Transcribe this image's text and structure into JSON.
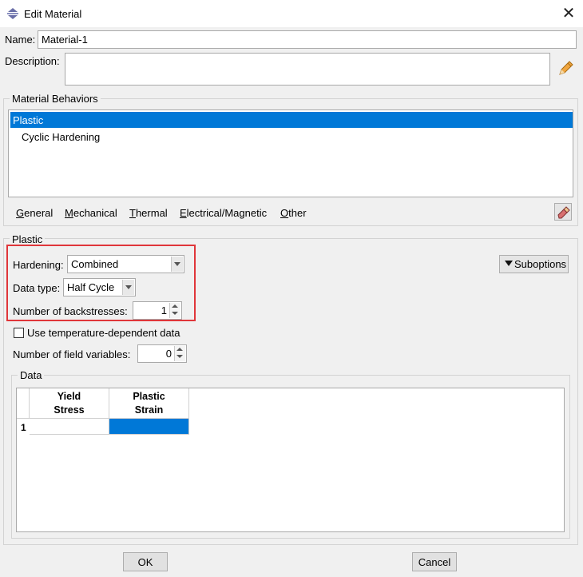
{
  "window": {
    "title": "Edit Material",
    "close_glyph": "✕"
  },
  "name_field": {
    "label": "Name:",
    "value": "Material-1"
  },
  "description_field": {
    "label": "Description:",
    "value": ""
  },
  "behaviors": {
    "title": "Material Behaviors",
    "items": [
      "Plastic",
      "Cyclic Hardening"
    ],
    "selected_index": 0
  },
  "menu": {
    "items": [
      {
        "label": "General",
        "mnemonic": "G",
        "rest": "eneral"
      },
      {
        "label": "Mechanical",
        "mnemonic": "M",
        "rest": "echanical"
      },
      {
        "label": "Thermal",
        "mnemonic": "T",
        "rest": "hermal"
      },
      {
        "label": "Electrical/Magnetic",
        "mnemonic": "E",
        "rest": "lectrical/Magnetic"
      },
      {
        "label": "Other",
        "mnemonic": "O",
        "rest": "ther"
      }
    ]
  },
  "plastic": {
    "title": "Plastic",
    "hardening": {
      "label": "Hardening:",
      "value": "Combined"
    },
    "data_type": {
      "label": "Data type:",
      "value": "Half Cycle"
    },
    "backstresses": {
      "label": "Number of backstresses:",
      "value": "1"
    },
    "temp_dependent": {
      "label": "Use temperature-dependent data",
      "checked": false
    },
    "field_vars": {
      "label": "Number of field variables:",
      "value": "0"
    },
    "suboptions": {
      "label": "Suboptions"
    }
  },
  "data_table": {
    "title": "Data",
    "columns": [
      {
        "line1": "Yield",
        "line2": "Stress"
      },
      {
        "line1": "Plastic",
        "line2": "Strain"
      }
    ],
    "rows": [
      {
        "index": "1",
        "values": [
          "",
          ""
        ]
      }
    ]
  },
  "footer": {
    "ok": "OK",
    "cancel": "Cancel"
  },
  "colors": {
    "selection": "#0078d7",
    "highlight": "#e0363a"
  }
}
